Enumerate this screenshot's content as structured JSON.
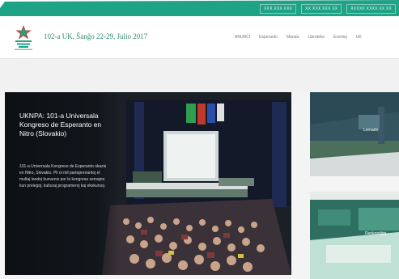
{
  "topbar": {
    "links": [
      "XXX XXX XXX",
      "XX XXX XXX XX",
      "XXXXX XXXX XX XX"
    ]
  },
  "header": {
    "title": "102-a UK, Ŝanĝo 22-29, Julio 2017",
    "nav": [
      "ANUNCI",
      "Esperanto",
      "Marato",
      "Libroteko",
      "Eventoj",
      "UK"
    ]
  },
  "hero": {
    "title": "UKNPA: 101-a Universala Kongreso de Esperanto en Nitro (Slovakio)",
    "description": "101-a Universala Kongreso de Esperanto okazis en Nitro, Slovakio. Pli ol mil partoprenantoj el multaj landoj kunvenis por la kongresa semajno kun prelegoj, kulturaj programeroj kaj ekskursoj."
  },
  "cards": [
    {
      "label": "Lernado"
    },
    {
      "label": "Renkontiĝoj"
    }
  ],
  "colors": {
    "accent": "#1fa386",
    "title_green": "#2d8a6c",
    "hero_bg": "#1b2027"
  }
}
